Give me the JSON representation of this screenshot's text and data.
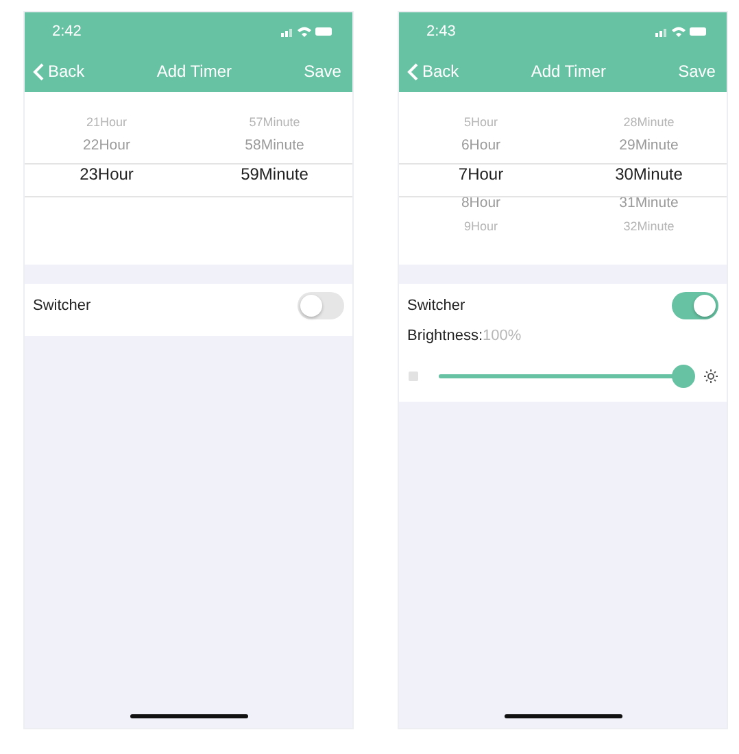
{
  "screens": [
    {
      "status_bar": {
        "time": "2:42"
      },
      "nav": {
        "back": "Back",
        "title": "Add Timer",
        "action": "Save"
      },
      "picker": {
        "hour": {
          "above": [
            "21Hour",
            "22Hour"
          ],
          "selected": "23Hour"
        },
        "minute": {
          "above": [
            "57Minute",
            "58Minute"
          ],
          "selected": "59Minute"
        }
      },
      "switcher": {
        "label": "Switcher",
        "on": false
      }
    },
    {
      "status_bar": {
        "time": "2:43"
      },
      "nav": {
        "back": "Back",
        "title": "Add Timer",
        "action": "Save"
      },
      "picker": {
        "hour": {
          "above": [
            "5Hour",
            "6Hour"
          ],
          "selected": "7Hour",
          "below": [
            "8Hour",
            "9Hour"
          ]
        },
        "minute": {
          "above": [
            "28Minute",
            "29Minute"
          ],
          "selected": "30Minute",
          "below": [
            "31Minute",
            "32Minute"
          ]
        }
      },
      "switcher": {
        "label": "Switcher",
        "on": true
      },
      "brightness": {
        "label": "Brightness:",
        "reading": "100%",
        "level": 1.0
      }
    }
  ]
}
